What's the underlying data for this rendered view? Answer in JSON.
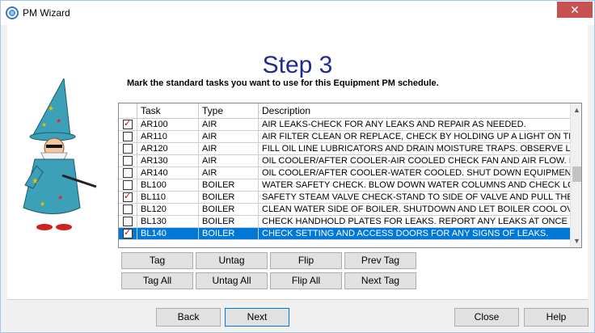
{
  "window": {
    "title": "PM Wizard",
    "close_glyph": "✕",
    "icon": "wizard-app-icon"
  },
  "header": {
    "step": "Step 3",
    "instruction": "Mark the standard tasks you want to use for this Equipment PM schedule."
  },
  "grid": {
    "columns": [
      "Task",
      "Type",
      "Description"
    ],
    "rows": [
      {
        "checked": true,
        "task": "AR100",
        "type": "AIR",
        "description": "AIR LEAKS-CHECK FOR ANY LEAKS AND REPAIR AS NEEDED.",
        "selected": false
      },
      {
        "checked": false,
        "task": "AR110",
        "type": "AIR",
        "description": "AIR FILTER CLEAN OR REPLACE, CHECK BY HOLDING UP A LIGHT ON THE",
        "selected": false
      },
      {
        "checked": false,
        "task": "AR120",
        "type": "AIR",
        "description": "FILL OIL LINE LUBRICATORS AND DRAIN MOISTURE TRAPS. OBSERVE LUE",
        "selected": false
      },
      {
        "checked": false,
        "task": "AR130",
        "type": "AIR",
        "description": "OIL COOLER/AFTER COOLER-AIR COOLED CHECK FAN AND AIR FLOW. I",
        "selected": false
      },
      {
        "checked": false,
        "task": "AR140",
        "type": "AIR",
        "description": "OIL COOLER/AFTER COOLER-WATER COOLED. SHUT DOWN EQUIPMENT",
        "selected": false
      },
      {
        "checked": false,
        "task": "BL100",
        "type": "BOILER",
        "description": "WATER SAFETY CHECK. BLOW DOWN WATER COLUMNS AND CHECK LO",
        "selected": false
      },
      {
        "checked": true,
        "task": "BL110",
        "type": "BOILER",
        "description": "SAFETY STEAM VALVE CHECK-STAND TO SIDE OF VALVE AND PULL THE",
        "selected": false
      },
      {
        "checked": false,
        "task": "BL120",
        "type": "BOILER",
        "description": "CLEAN WATER SIDE OF BOILER.  SHUTDOWN AND LET BOILER COOL OV",
        "selected": false
      },
      {
        "checked": false,
        "task": "BL130",
        "type": "BOILER",
        "description": "CHECK HANDHOLD PLATES FOR LEAKS. REPORT ANY LEAKS AT ONCE T",
        "selected": false
      },
      {
        "checked": true,
        "task": "BL140",
        "type": "BOILER",
        "description": "CHECK SETTING AND ACCESS DOORS FOR ANY SIGNS OF LEAKS.",
        "selected": true
      }
    ],
    "scroll_up": "▲",
    "scroll_down": "▼"
  },
  "actions": {
    "tag": "Tag",
    "untag": "Untag",
    "flip": "Flip",
    "prev_tag": "Prev Tag",
    "tag_all": "Tag All",
    "untag_all": "Untag All",
    "flip_all": "Flip All",
    "next_tag": "Next Tag"
  },
  "footer": {
    "back": "Back",
    "next": "Next",
    "close": "Close",
    "help": "Help"
  },
  "colors": {
    "accent": "#0078d7",
    "step_title": "#1f2c8f",
    "check": "#d00000",
    "close_button": "#c75050"
  }
}
